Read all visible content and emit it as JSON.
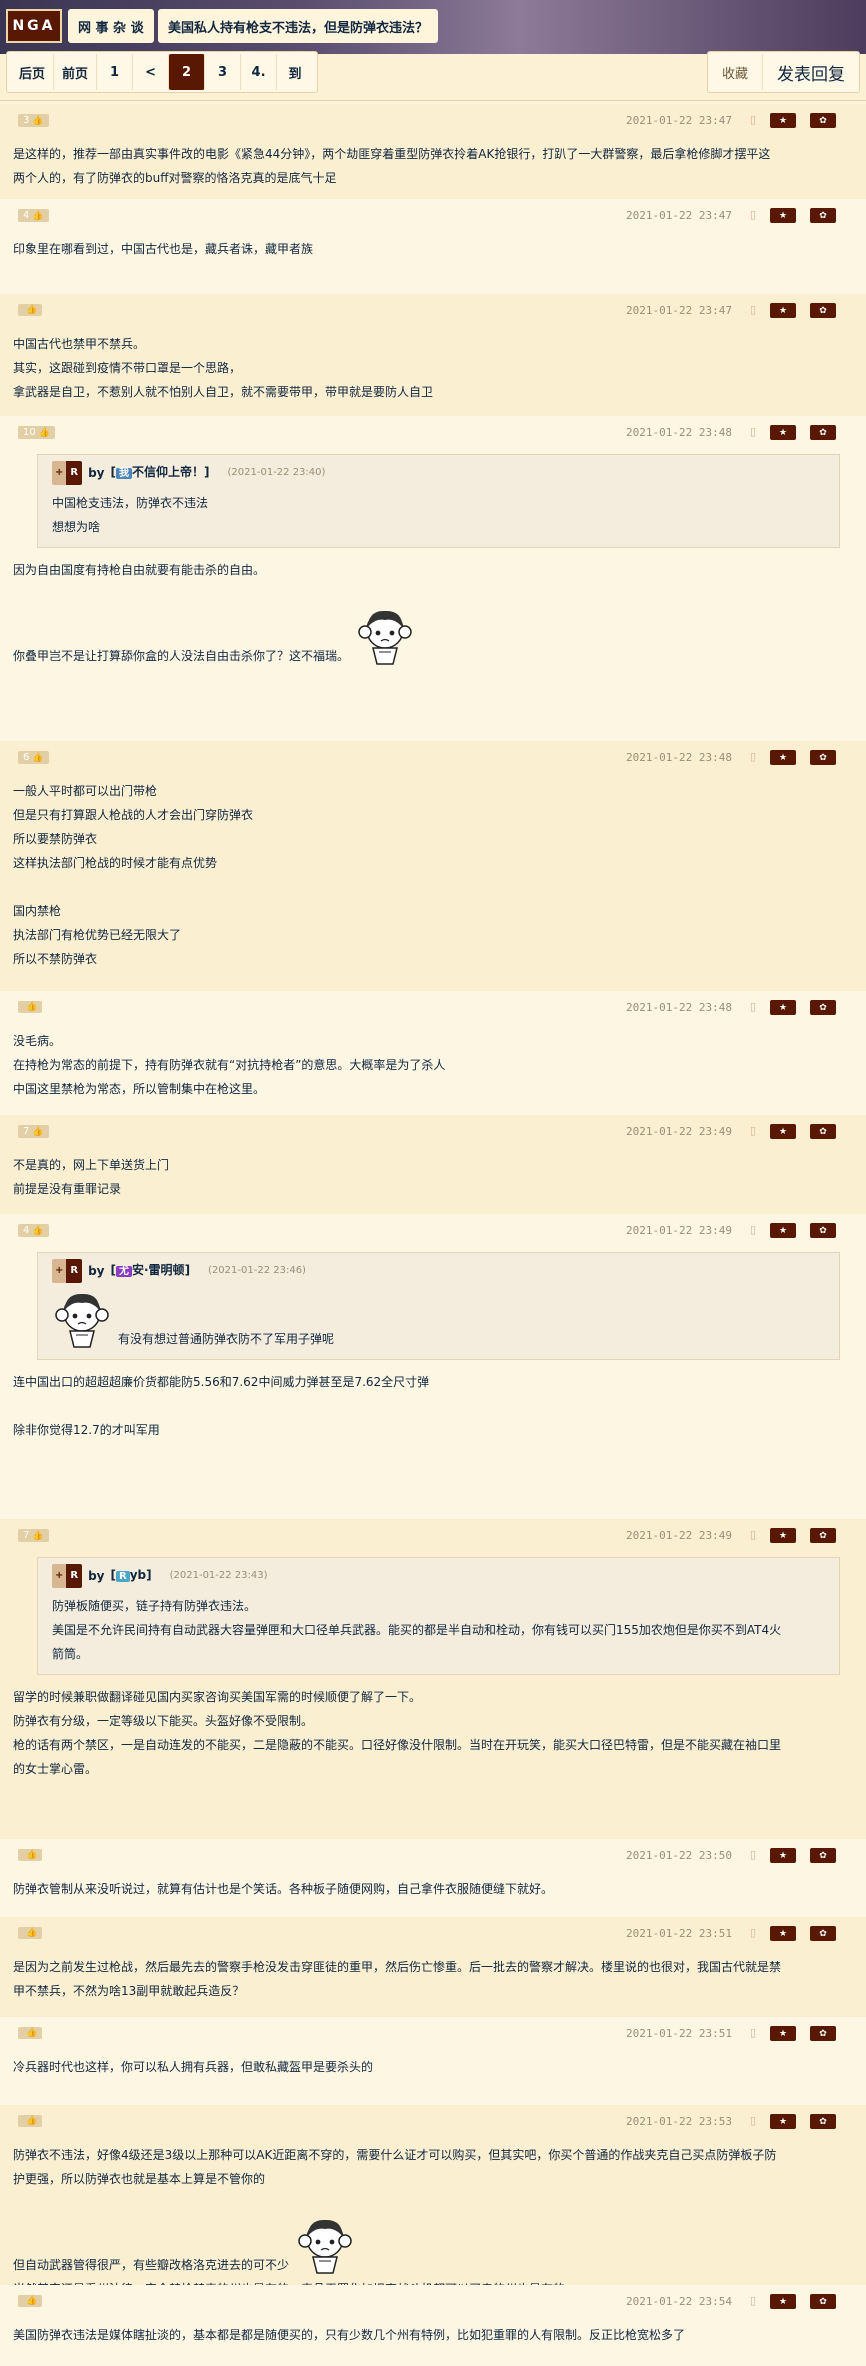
{
  "header": {
    "logo": "NGA",
    "forum": "网 事 杂 谈",
    "thread_title": "美国私人持有枪支不违法，但是防弹衣违法？"
  },
  "pager": {
    "first": "后页",
    "prev": "前页",
    "p1": "1",
    "lt": "<",
    "p2": "2",
    "p3": "3",
    "p4": "4.",
    "goto": "到"
  },
  "actions": {
    "favorite": "收藏",
    "reply": "发表回复"
  },
  "accent": "#591804",
  "posts": [
    {
      "likes": "3",
      "time": "2021-01-22 23:47",
      "lines": [
        "是这样的，推荐一部由真实事件改的电影《紧急44分钟》，两个劫匪穿着重型防弹衣拎着AK抢银行，打趴了一大群警察，最后拿枪修脚才摆平这",
        "两个人的，有了防弹衣的buff对警察的恪洛克真的是底气十足"
      ]
    },
    {
      "likes": "4",
      "time": "2021-01-22 23:47",
      "lines": [
        "印象里在哪看到过，中国古代也是，藏兵者诛，藏甲者族"
      ]
    },
    {
      "likes": "",
      "time": "2021-01-22 23:47",
      "lines": [
        "中国古代也禁甲不禁兵。",
        "其实，这跟碰到疫情不带口罩是一个思路，",
        "拿武器是自卫，不惹别人就不怕别人自卫，就不需要带甲，带甲就是要防人自卫"
      ]
    },
    {
      "likes": "10",
      "time": "2021-01-22 23:48",
      "quote": {
        "by": "by",
        "avatar_letter": "我",
        "user": "不信仰上帝！",
        "time": "(2021-01-22 23:40)",
        "lines": [
          "中国枪支违法，防弹衣不违法",
          "想想为啥"
        ]
      },
      "lines": [
        "因为自由国度有持枪自由就要有能击杀的自由。",
        "",
        "你叠甲岂不是让打算舔你盒的人没法自由击杀你了？这不福瑞。"
      ]
    },
    {
      "likes": "6",
      "time": "2021-01-22 23:48",
      "lines": [
        "一般人平时都可以出门带枪",
        "但是只有打算跟人枪战的人才会出门穿防弹衣",
        "所以要禁防弹衣",
        "这样执法部门枪战的时候才能有点优势",
        "",
        "国内禁枪",
        "执法部门有枪优势已经无限大了",
        "所以不禁防弹衣"
      ]
    },
    {
      "likes": "",
      "time": "2021-01-22 23:48",
      "lines": [
        "没毛病。",
        "在持枪为常态的前提下，持有防弹衣就有“对抗持枪者”的意思。大概率是为了杀人",
        "中国这里禁枪为常态，所以管制集中在枪这里。"
      ]
    },
    {
      "likes": "7",
      "time": "2021-01-22 23:49",
      "lines": [
        "不是真的，网上下单送货上门",
        "前提是没有重罪记录"
      ]
    },
    {
      "likes": "4",
      "time": "2021-01-22 23:49",
      "quote": {
        "by": "by",
        "avatar_letter": "尤",
        "user": "安·雷明顿",
        "time": "(2021-01-22 23:46)",
        "lines": [
          "有没有想过普通防弹衣防不了军用子弹呢"
        ]
      },
      "lines": [
        "连中国出口的超超超廉价货都能防5.56和7.62中间威力弹甚至是7.62全尺寸弹",
        "",
        "除非你觉得12.7的才叫军用"
      ]
    },
    {
      "likes": "7",
      "time": "2021-01-22 23:49",
      "quote": {
        "by": "by",
        "avatar_letter": "R",
        "user": "yb",
        "time": "(2021-01-22 23:43)",
        "lines": [
          "防弹板随便买，链子持有防弹衣违法。",
          "美国是不允许民间持有自动武器大容量弹匣和大口径单兵武器。能买的都是半自动和栓动，你有钱可以买门155加农炮但是你买不到AT4火",
          "箭筒。"
        ]
      },
      "lines": [
        "留学的时候兼职做翻译碰见国内买家咨询买美国军需的时候顺便了解了一下。",
        "防弹衣有分级，一定等级以下能买。头盔好像不受限制。",
        "枪的话有两个禁区，一是自动连发的不能买，二是隐蔽的不能买。口径好像没什限制。当时在开玩笑，能买大口径巴特雷，但是不能买藏在袖口里",
        "的女士掌心雷。"
      ]
    },
    {
      "likes": "",
      "time": "2021-01-22 23:50",
      "lines": [
        "防弹衣管制从来没听说过，就算有估计也是个笑话。各种板子随便网购，自己拿件衣服随便缝下就好。"
      ]
    },
    {
      "likes": "",
      "time": "2021-01-22 23:51",
      "lines": [
        "是因为之前发生过枪战，然后最先去的警察手枪没发击穿匪徒的重甲，然后伤亡惨重。后一批去的警察才解决。楼里说的也很对，我国古代就是禁",
        "甲不禁兵，不然为啥13副甲就敢起兵造反？"
      ]
    },
    {
      "likes": "",
      "time": "2021-01-22 23:51",
      "lines": [
        "冷兵器时代也这样，你可以私人拥有兵器，但敢私藏盔甲是要杀头的"
      ]
    },
    {
      "likes": "",
      "time": "2021-01-22 23:53",
      "lines": [
        "防弹衣不违法，好像4级还是3级以上那种可以AK近距离不穿的，需要什么证才可以购买，但其实吧，你买个普通的作战夹克自己买点防弹板子防",
        "护更强，所以防弹衣也就是基本上算是不管你的",
        "",
        "但自动武器管得很严，有些瓣改格洛克进去的可不少",
        "当然其实还是看州法律，完全禁枪禁毒的州也是有的，毒品无罪化加坦克战斗机都可以买卖的州也是有的"
      ]
    },
    {
      "likes": "",
      "time": "2021-01-22 23:54",
      "lines": [
        "美国防弹衣违法是媒体瞎扯淡的，基本都是都是随便买的，只有少数几个州有特例，比如犯重罪的人有限制。反正比枪宽松多了"
      ]
    }
  ]
}
